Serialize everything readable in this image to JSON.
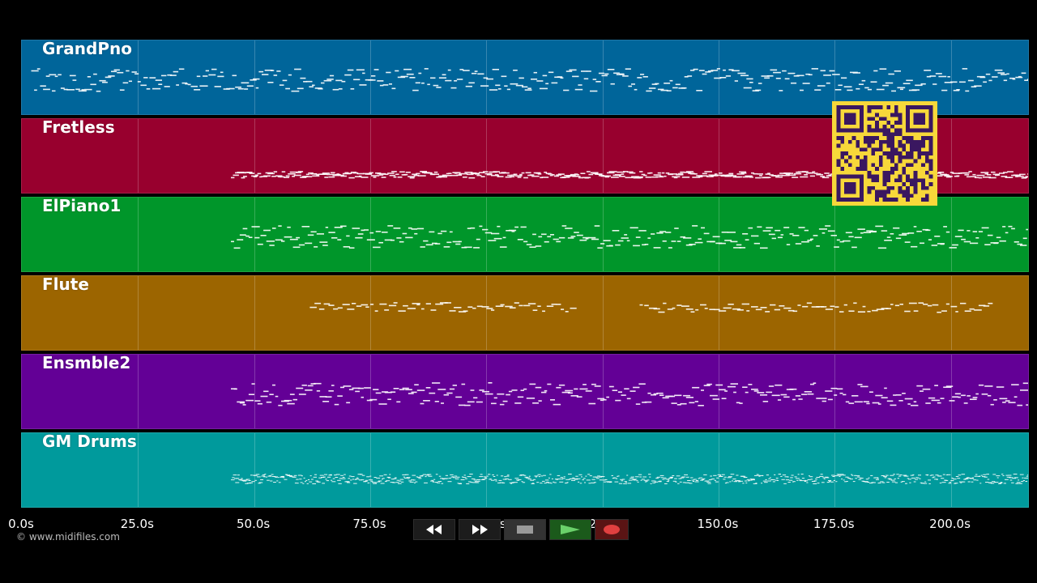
{
  "tracks": [
    {
      "name": "GrandPno",
      "color": "#00659a"
    },
    {
      "name": "Fretless",
      "color": "#98002e"
    },
    {
      "name": "ElPiano1",
      "color": "#00962a"
    },
    {
      "name": "Flute",
      "color": "#9c6500"
    },
    {
      "name": "Ensmble2",
      "color": "#630096"
    },
    {
      "name": "GM Drums",
      "color": "#009a9c"
    }
  ],
  "axis": {
    "ticks": [
      "0.0s",
      "25.0s",
      "50.0s",
      "75.0s",
      "100.0s",
      "125.0s",
      "150.0s",
      "175.0s",
      "200.0s"
    ],
    "max_seconds": 217
  },
  "copyright": "© www.midifiles.com",
  "transport": {
    "rewind_icon": "rewind-icon",
    "forward_icon": "fast-forward-icon",
    "stop_icon": "stop-icon",
    "play_icon": "play-icon",
    "record_icon": "record-icon"
  },
  "qr_code": {
    "color": "#f7d83a",
    "dark": "#3a1760"
  }
}
